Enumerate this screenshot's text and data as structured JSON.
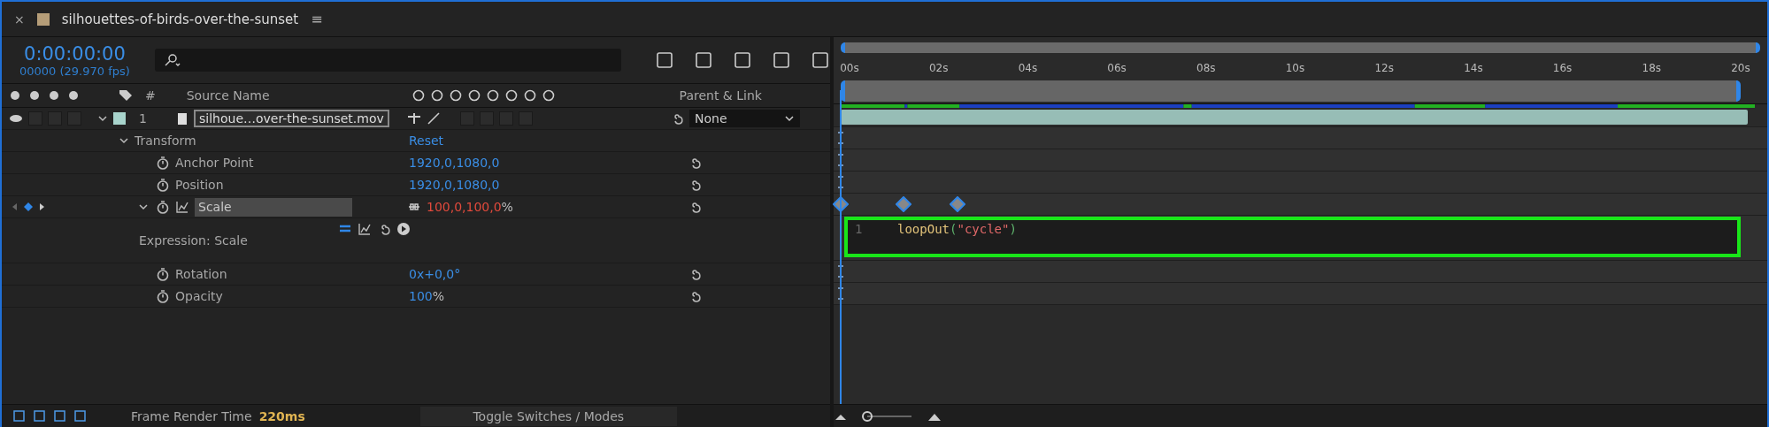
{
  "tab": {
    "title": "silhouettes-of-birds-over-the-sunset",
    "color": "#b59d78",
    "close": "×",
    "menu": "≡"
  },
  "timecode": "0:00:00:00",
  "frame_info": "00000 (29.970 fps)",
  "columns": {
    "number": "#",
    "source_name": "Source Name",
    "parent": "Parent & Link"
  },
  "layer": {
    "number": "1",
    "name": "silhoue…over-the-sunset.mov",
    "color": "#a8d4cc",
    "expanded": true,
    "parent": "None"
  },
  "transform": {
    "label": "Transform",
    "reset": "Reset",
    "expanded": true
  },
  "properties": [
    {
      "kind": "static",
      "name": "Anchor Point",
      "value": "1920,0,1080,0"
    },
    {
      "kind": "static",
      "name": "Position",
      "value": "1920,0,1080,0"
    },
    {
      "kind": "keyframed",
      "name": "Scale",
      "value": "100,0,100,0",
      "unit": "%",
      "expanded": true
    },
    {
      "kind": "expression",
      "label": "Expression: Scale",
      "line_number": "1",
      "code": [
        {
          "kind": "fn",
          "text": "loopOut"
        },
        {
          "kind": "punct",
          "text": "("
        },
        {
          "kind": "string",
          "text": "\"cycle\""
        },
        {
          "kind": "punct",
          "text": ")"
        }
      ]
    },
    {
      "kind": "static",
      "name": "Rotation",
      "value": "0x+0,0°"
    },
    {
      "kind": "static",
      "name": "Opacity",
      "value": "100",
      "unit": "%"
    }
  ],
  "ruler": [
    "00s",
    "02s",
    "04s",
    "06s",
    "08s",
    "10s",
    "12s",
    "14s",
    "16s",
    "18s",
    "20s"
  ],
  "status": {
    "label": "Frame Render Time",
    "value": "220ms",
    "toggle": "Toggle Switches / Modes"
  }
}
